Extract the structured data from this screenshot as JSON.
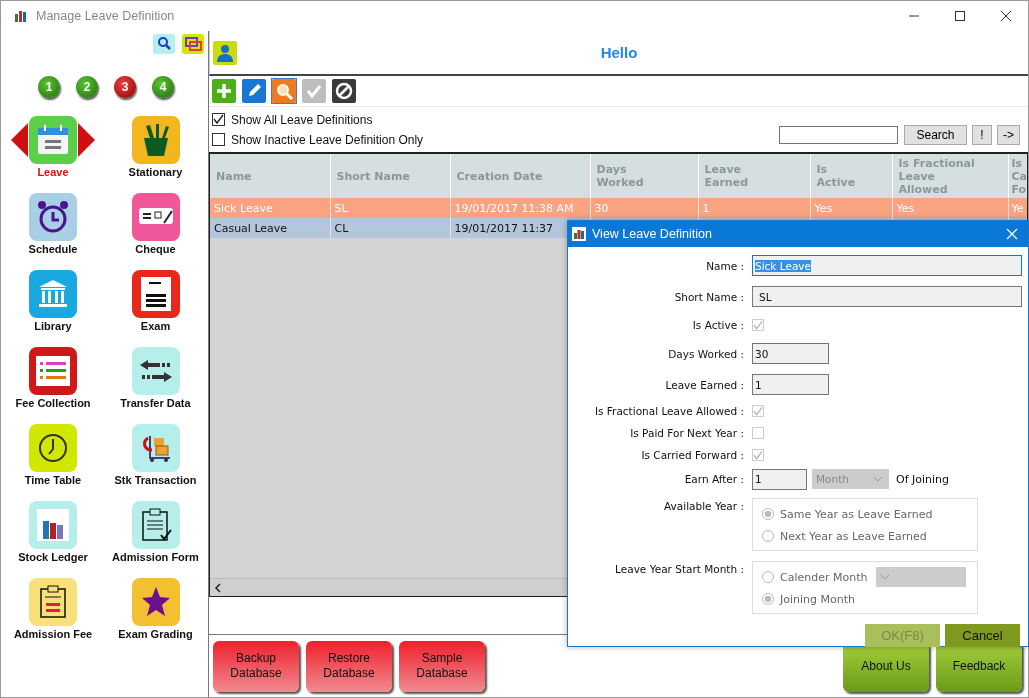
{
  "window": {
    "title": "Manage Leave Definition"
  },
  "sidebar": {
    "pages": [
      {
        "label": "1",
        "selected": false
      },
      {
        "label": "2",
        "selected": false
      },
      {
        "label": "3",
        "selected": true
      },
      {
        "label": "4",
        "selected": false
      }
    ],
    "modules": [
      {
        "label": "Leave",
        "selected": true
      },
      {
        "label": "Stationary",
        "selected": false
      },
      {
        "label": "Schedule",
        "selected": false
      },
      {
        "label": "Cheque",
        "selected": false
      },
      {
        "label": "Library",
        "selected": false
      },
      {
        "label": "Exam",
        "selected": false
      },
      {
        "label": "Fee Collection",
        "selected": false
      },
      {
        "label": "Transfer Data",
        "selected": false
      },
      {
        "label": "Time Table",
        "selected": false
      },
      {
        "label": "Stk Transaction",
        "selected": false
      },
      {
        "label": "Stock Ledger",
        "selected": false
      },
      {
        "label": "Admission Form",
        "selected": false
      },
      {
        "label": "Admission Fee",
        "selected": false
      },
      {
        "label": "Exam Grading",
        "selected": false
      }
    ]
  },
  "header": {
    "greeting": "Hello"
  },
  "toolbar": [
    {
      "kind": "add",
      "selected": false,
      "disabled": false
    },
    {
      "kind": "edit",
      "selected": false,
      "disabled": false
    },
    {
      "kind": "view",
      "selected": true,
      "disabled": false
    },
    {
      "kind": "approve",
      "selected": false,
      "disabled": true
    },
    {
      "kind": "deactivate",
      "selected": false,
      "disabled": false
    }
  ],
  "filters": [
    {
      "label": "Show All Leave Definitions",
      "checked": true
    },
    {
      "label": "Show Inactive Leave Definition Only",
      "checked": false
    }
  ],
  "search": {
    "button": "Search",
    "extra_buttons": [
      "!",
      "->"
    ]
  },
  "table": {
    "columns": [
      "Name",
      "Short Name",
      "Creation Date",
      "Days\nWorked",
      "Leave\nEarned",
      "Is\nActive",
      "Is Fractional\nLeave\nAllowed",
      "Is\nCa\nFo"
    ],
    "rows": [
      {
        "selected": true,
        "cells": [
          "Sick Leave",
          "SL",
          "19/01/2017 11:38 AM",
          "30",
          "1",
          "Yes",
          "Yes",
          "Ye"
        ]
      },
      {
        "selected": false,
        "cells": [
          "Casual Leave",
          "CL",
          "19/01/2017 11:37"
        ]
      }
    ]
  },
  "footer": {
    "left_buttons": [
      "Backup Database",
      "Restore Database",
      "Sample Database"
    ],
    "right_buttons": [
      "About Us",
      "Feedback"
    ]
  },
  "dialog": {
    "title": "View Leave Definition",
    "fields": [
      {
        "kind": "text",
        "label": "Name :",
        "value": "Sick Leave",
        "focused": true
      },
      {
        "kind": "text",
        "label": "Short Name :",
        "value": "SL",
        "focused": false
      },
      {
        "kind": "check",
        "label": "Is Active :",
        "checked": true,
        "disabled": true
      },
      {
        "kind": "number",
        "label": "Days Worked :",
        "value": "30",
        "focused": false
      },
      {
        "kind": "number",
        "label": "Leave Earned :",
        "value": "1",
        "focused": false
      },
      {
        "kind": "check",
        "label": "Is Fractional Leave Allowed :",
        "checked": true,
        "disabled": true
      },
      {
        "kind": "check",
        "label": "Is Paid For Next Year :",
        "checked": false,
        "disabled": true
      },
      {
        "kind": "check",
        "label": "Is Carried Forward :",
        "checked": true,
        "disabled": true
      },
      {
        "kind": "earn",
        "label": "Earn After :",
        "value": "1",
        "unit": "Month",
        "suffix": "Of Joining"
      },
      {
        "kind": "radio",
        "label": "Available Year :",
        "disabled": true,
        "options": [
          {
            "label": "Same Year as Leave Earned",
            "selected": true,
            "has_dropdown": false
          },
          {
            "label": "Next Year as Leave Earned",
            "selected": false,
            "has_dropdown": false
          }
        ]
      },
      {
        "kind": "radio",
        "label": "Leave Year Start Month :",
        "disabled": true,
        "options": [
          {
            "label": "Calender Month",
            "selected": false,
            "has_dropdown": true
          },
          {
            "label": "Joining Month",
            "selected": true,
            "has_dropdown": false
          }
        ]
      }
    ],
    "buttons": [
      {
        "label": "OK(F8)",
        "disabled": true
      },
      {
        "label": "Cancel",
        "disabled": false
      }
    ]
  }
}
